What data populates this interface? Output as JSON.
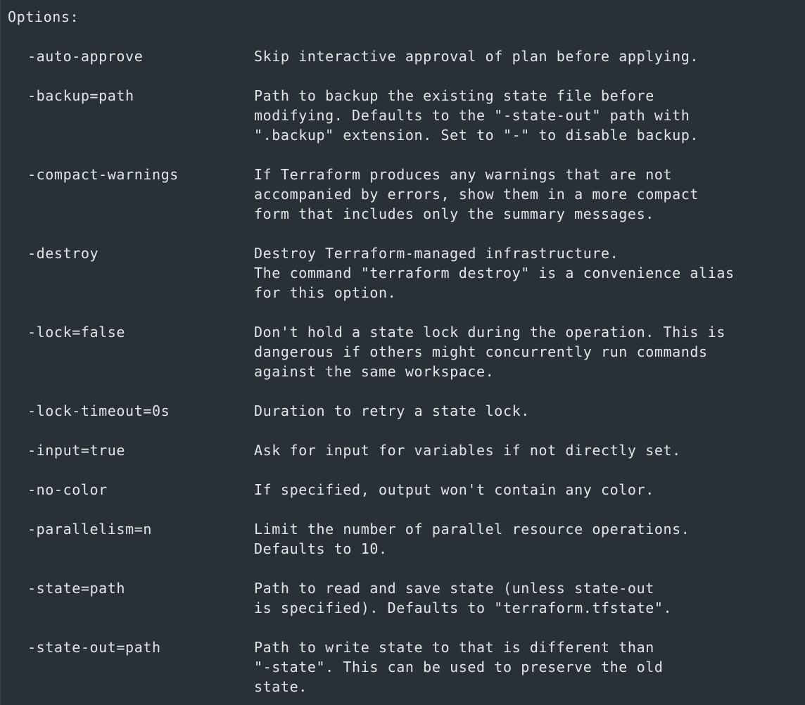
{
  "terminal": {
    "heading": "Options:",
    "options": [
      {
        "flag": "-auto-approve",
        "description": [
          "Skip interactive approval of plan before applying."
        ]
      },
      {
        "flag": "-backup=path",
        "description": [
          "Path to backup the existing state file before",
          "modifying. Defaults to the \"-state-out\" path with",
          "\".backup\" extension. Set to \"-\" to disable backup."
        ]
      },
      {
        "flag": "-compact-warnings",
        "description": [
          "If Terraform produces any warnings that are not",
          "accompanied by errors, show them in a more compact",
          "form that includes only the summary messages."
        ]
      },
      {
        "flag": "-destroy",
        "description": [
          "Destroy Terraform-managed infrastructure.",
          "The command \"terraform destroy\" is a convenience alias",
          "for this option."
        ]
      },
      {
        "flag": "-lock=false",
        "description": [
          "Don't hold a state lock during the operation. This is",
          "dangerous if others might concurrently run commands",
          "against the same workspace."
        ]
      },
      {
        "flag": "-lock-timeout=0s",
        "description": [
          "Duration to retry a state lock."
        ]
      },
      {
        "flag": "-input=true",
        "description": [
          "Ask for input for variables if not directly set."
        ]
      },
      {
        "flag": "-no-color",
        "description": [
          "If specified, output won't contain any color."
        ]
      },
      {
        "flag": "-parallelism=n",
        "description": [
          "Limit the number of parallel resource operations.",
          "Defaults to 10."
        ]
      },
      {
        "flag": "-state=path",
        "description": [
          "Path to read and save state (unless state-out",
          "is specified). Defaults to \"terraform.tfstate\"."
        ]
      },
      {
        "flag": "-state-out=path",
        "description": [
          "Path to write state to that is different than",
          "\"-state\". This can be used to preserve the old",
          "state."
        ]
      }
    ]
  },
  "colors": {
    "background": "#2a3037",
    "foreground": "#e3e6e8"
  }
}
